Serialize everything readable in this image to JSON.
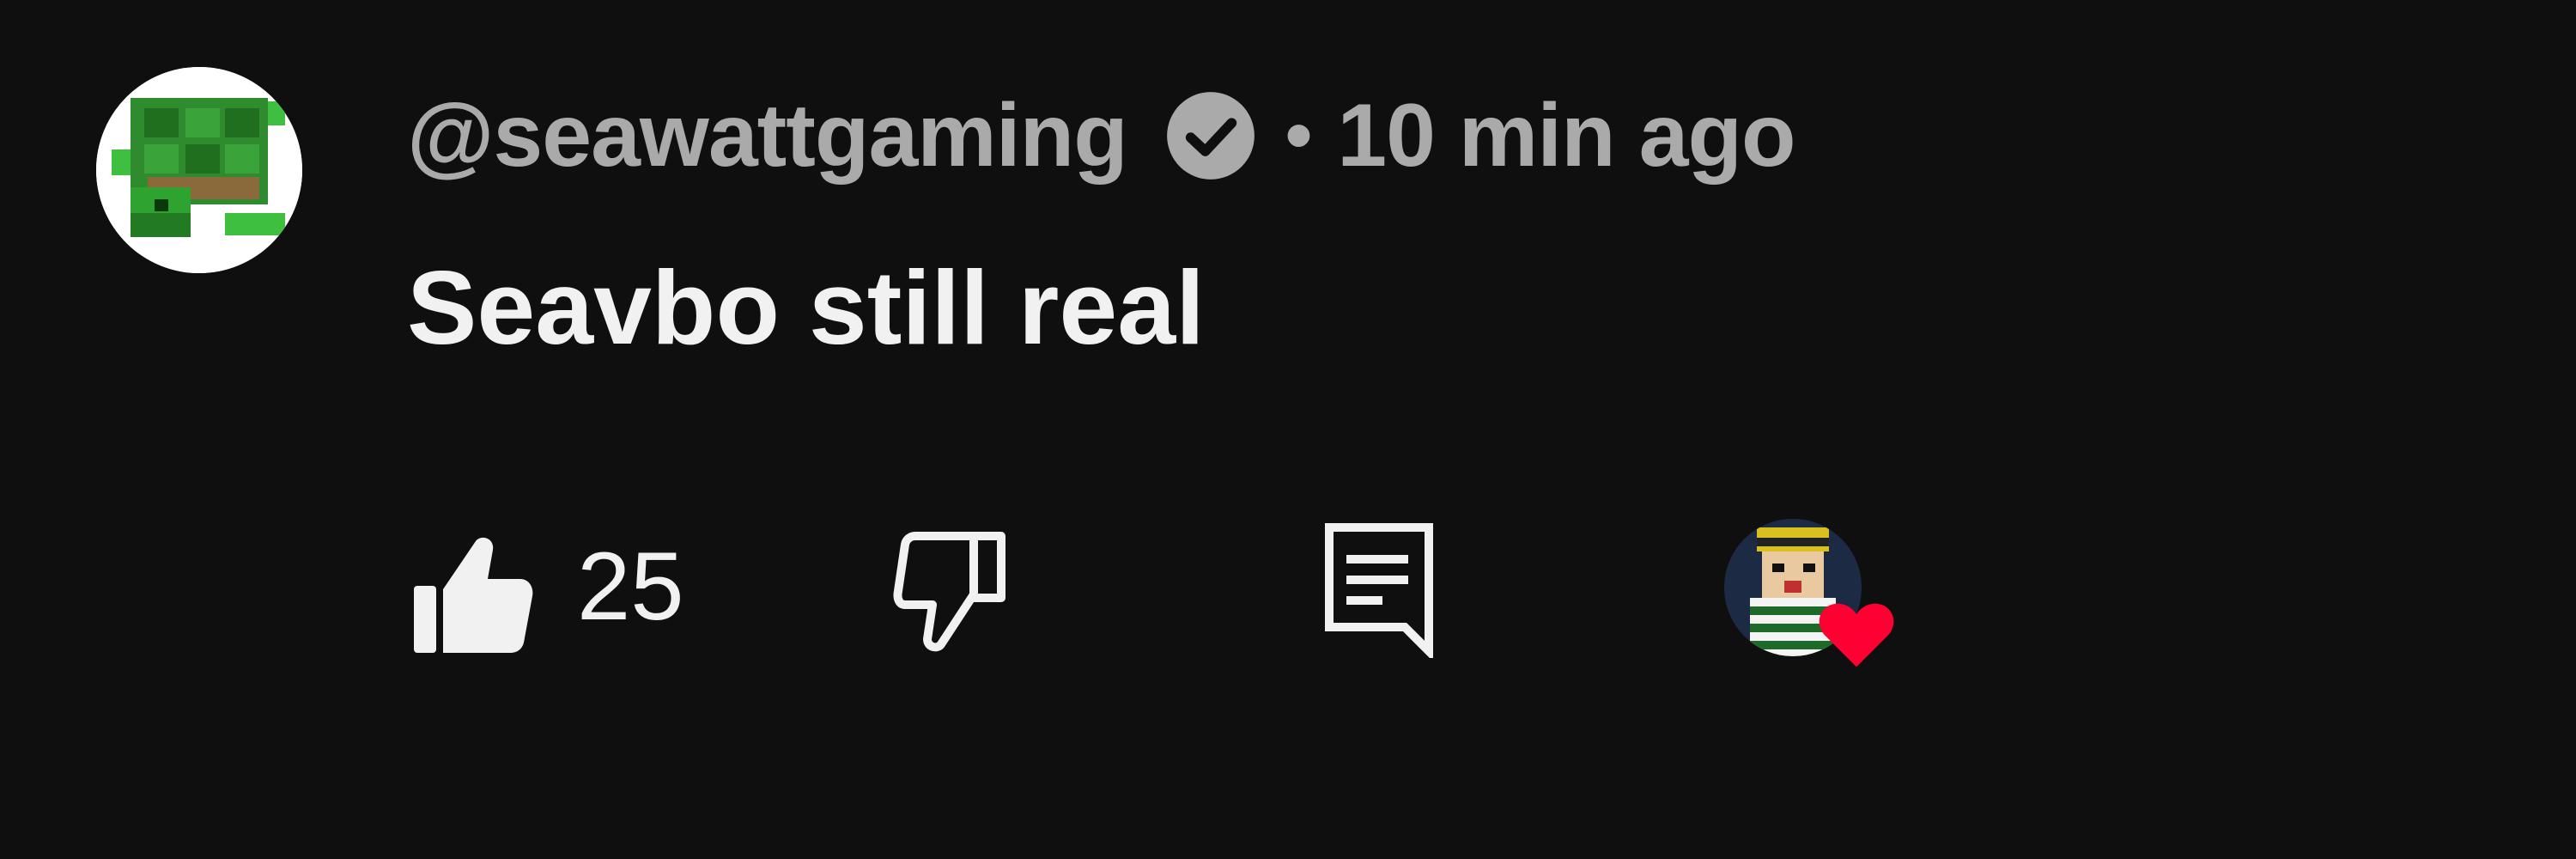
{
  "comment": {
    "author": "@seawattgaming",
    "verified": true,
    "separator": "•",
    "time": "10 min ago",
    "text": "Seavbo still real"
  },
  "actions": {
    "like_count": "25",
    "like_icon": "thumbs-up-icon",
    "dislike_icon": "thumbs-down-icon",
    "reply_icon": "reply-comment-icon",
    "creator_heart_icon": "heart-icon"
  },
  "colors": {
    "background": "#0f0f0f",
    "primary_text": "#f1f1f1",
    "secondary_text": "#aaaaaa",
    "heart": "#ff0033"
  }
}
